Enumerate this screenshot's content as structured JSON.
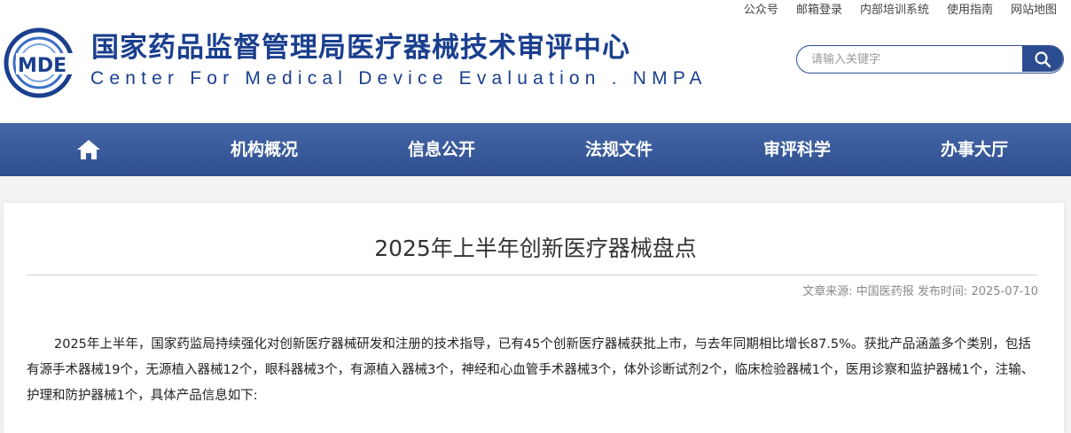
{
  "top_links": [
    "公众号",
    "邮箱登录",
    "内部培训系统",
    "使用指南",
    "网站地图"
  ],
  "logo": {
    "emblem_text": "MDE",
    "cn_name": "国家药品监督管理局医疗器械技术审评中心",
    "en_name": "Center For Medical Device Evaluation . NMPA"
  },
  "search": {
    "placeholder": "请输入关键字",
    "value": ""
  },
  "nav": {
    "home_icon": "home-icon",
    "items": [
      "机构概况",
      "信息公开",
      "法规文件",
      "审评科学",
      "办事大厅"
    ]
  },
  "article": {
    "title": "2025年上半年创新医疗器械盘点",
    "source_label": "文章来源:",
    "source": "中国医药报",
    "date_label": "发布时间:",
    "date": "2025-07-10",
    "paragraph": "2025年上半年，国家药监局持续强化对创新医疗器械研发和注册的技术指导，已有45个创新医疗器械获批上市，与去年同期相比增长87.5%。获批产品涵盖多个类别，包括有源手术器械19个，无源植入器械12个，眼科器械3个，有源植入器械3个，神经和心血管手术器械3个，体外诊断试剂2个，临床检验器械1个，医用诊察和监护器械1个，注输、护理和防护器械1个，具体产品信息如下:"
  },
  "colors": {
    "brand_blue": "#1a3f8e",
    "nav_bg": "#3b5b9b",
    "search_btn": "#2b4d8f"
  }
}
